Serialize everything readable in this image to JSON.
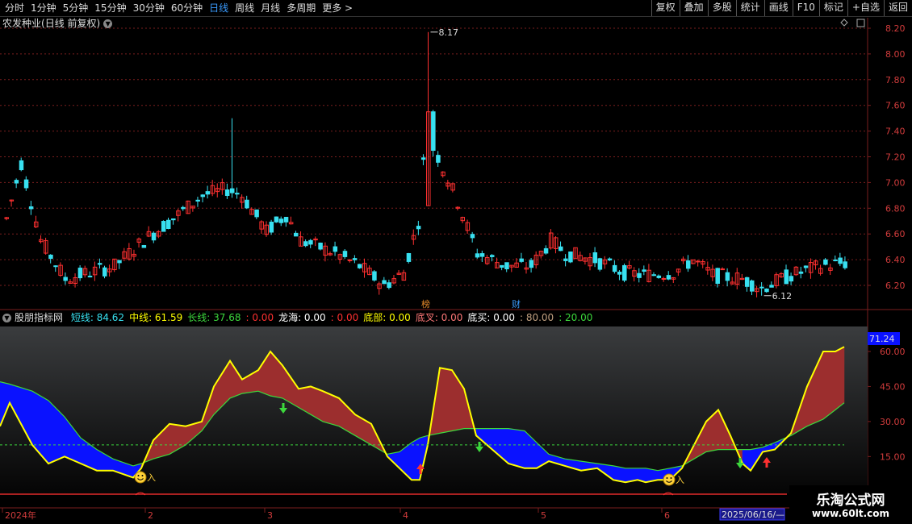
{
  "toolbar": {
    "periods": [
      "分时",
      "1分钟",
      "5分钟",
      "15分钟",
      "30分钟",
      "60分钟",
      "日线",
      "周线",
      "月线",
      "多周期",
      "更多 >"
    ],
    "active_period": "日线",
    "tools": [
      "复权",
      "叠加",
      "多股",
      "统计",
      "画线",
      "F10",
      "标记",
      "+自选",
      "返回"
    ]
  },
  "stock": {
    "name": "农发种业",
    "period_label": "(日线 前复权)",
    "high_label": "8.17",
    "low_label": "6.12",
    "markers": [
      "榜",
      "财"
    ]
  },
  "colors": {
    "up": "#ff3030",
    "down": "#38e0f0",
    "short_line": "#ffff00",
    "mid_line": "#3cd83c",
    "fill_blue": "#0a12ff",
    "fill_red": "#9c2e2e",
    "grid": "#7a1e1e",
    "axis_text": "#d23c3c"
  },
  "price_axis": {
    "ticks": [
      "8.20",
      "8.00",
      "7.80",
      "7.60",
      "7.40",
      "7.20",
      "7.00",
      "6.80",
      "6.60",
      "6.40",
      "6.20"
    ]
  },
  "indicator": {
    "name": "股朋指标网",
    "items": [
      {
        "label": "短线:",
        "value": "84.62",
        "color": "#38e0f0"
      },
      {
        "label": "中线:",
        "value": "61.59",
        "color": "#ffff00"
      },
      {
        "label": "长线:",
        "value": "37.68",
        "color": "#3cd83c"
      },
      {
        "label": ":",
        "value": "0.00",
        "color": "#ff3030"
      },
      {
        "label": "龙海:",
        "value": "0.00",
        "color": "#ffffff"
      },
      {
        "label": ":",
        "value": "0.00",
        "color": "#ff3030"
      },
      {
        "label": "底部:",
        "value": "0.00",
        "color": "#ffff00"
      },
      {
        "label": "底叉:",
        "value": "0.00",
        "color": "#ff7878"
      },
      {
        "label": "底买:",
        "value": "0.00",
        "color": "#ffffff"
      },
      {
        "label": ":",
        "value": "80.00",
        "color": "#c0a080"
      },
      {
        "label": ":",
        "value": "20.00",
        "color": "#3cd83c"
      }
    ],
    "axis_ticks": [
      "60.00",
      "45.00",
      "30.00",
      "15.00"
    ],
    "current_value": "71.24",
    "buy_text": "入"
  },
  "time_axis": {
    "labels": [
      "2024年",
      "2",
      "3",
      "4",
      "5",
      "6"
    ],
    "cursor_date": "2025/06/16/—"
  },
  "watermark": {
    "title": "乐淘公式网",
    "url": "www.60lt.com"
  }
}
